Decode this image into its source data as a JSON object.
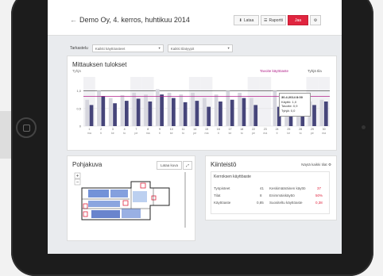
{
  "page": {
    "title": "Demo Oy, 4. kerros, huhtikuu 2014",
    "back_glyph": "←"
  },
  "toolbar": {
    "btn1": "Lataa",
    "btn2": "Raportti",
    "btn3": "Jaa",
    "btn4_glyph": "⚙"
  },
  "filters": {
    "label": "Tarkastelu",
    "select1": "Kaikki käyttöasteet",
    "select2": "Kaikki tilatyypit"
  },
  "chart": {
    "title": "Mittauksen tulokset",
    "left_label": "Tyhjä",
    "legend_target": "Tavoite käyttöaste",
    "legend_empty": "Tyhjä tila",
    "tooltip": {
      "title": "30.4.2014 8:00",
      "line1": "Käyttö: 1,0",
      "line2": "Tavoite: 0,9",
      "line3": "Tyhjä: 0,0"
    }
  },
  "chart_data": {
    "type": "bar",
    "categories": [
      "1",
      "2",
      "3",
      "4",
      "7",
      "8",
      "9",
      "10",
      "11",
      "14",
      "15",
      "16",
      "17",
      "18",
      "22",
      "23",
      "24",
      "25",
      "28",
      "29",
      "30"
    ],
    "x_labels": [
      "ma",
      "ti",
      "ke",
      "to",
      "pe",
      "ma",
      "ti",
      "ke",
      "to",
      "pe",
      "ma",
      "ti",
      "ke",
      "to",
      "pe",
      "ma",
      "ti",
      "ke",
      "to",
      "pe",
      "ma",
      "ti",
      "ke"
    ],
    "series": [
      {
        "name": "Käyttö",
        "values": [
          0.6,
          0.85,
          0.65,
          0.72,
          0.78,
          0.7,
          0.9,
          0.8,
          0.68,
          0.72,
          0.55,
          0.7,
          0.75,
          0.8,
          0.6,
          0.0,
          0.55,
          0.45,
          0.66,
          0.6,
          0.7
        ]
      },
      {
        "name": "Tyhjä",
        "values": [
          0.75,
          1.0,
          0.8,
          0.88,
          0.95,
          0.9,
          1.05,
          0.95,
          0.9,
          0.95,
          0.8,
          0.9,
          1.0,
          0.95,
          0.8,
          0.0,
          1.0,
          0.7,
          0.85,
          0.7,
          0.75
        ]
      }
    ],
    "target_line": 0.85,
    "ylim": [
      0,
      1.4
    ],
    "yticks": [
      "1,0",
      "0,5",
      "0"
    ]
  },
  "floorplan_card": {
    "title": "Pohjakuva",
    "button": "Lataa kuva",
    "expand_glyph": "⤢"
  },
  "properties": {
    "title": "Kiinteistö",
    "link": "Näytä kaikki tilat",
    "box_title": "Kerroksen käyttöaste",
    "rows": [
      {
        "label": "Työpisteet",
        "value": "41",
        "label2": "Keskimääräinen käyttö",
        "value2": "37"
      },
      {
        "label": "Tilat",
        "value": "8",
        "label2": "Enimmäiskäyttö",
        "value2": "50%"
      },
      {
        "label": "Käyttöaste",
        "value": "0,85",
        "label2": "Suositeltu käyttöaste",
        "value2": "0,38"
      }
    ]
  },
  "colors": {
    "accent": "#e0253f",
    "bar_used": "#46457a",
    "bar_empty": "#d6d6de",
    "target_line": "#b01e88"
  }
}
